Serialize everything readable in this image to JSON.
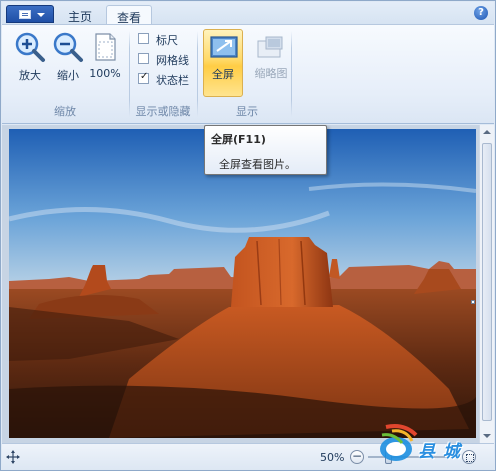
{
  "tabs": {
    "home": "主页",
    "view": "查看"
  },
  "help_icon": "?",
  "groups": {
    "zoom": {
      "label": "缩放",
      "zoom_in": "放大",
      "zoom_out": "缩小",
      "actual_size": "100%"
    },
    "show_hide": {
      "label": "显示或隐藏",
      "ruler": {
        "label": "标尺",
        "checked": false
      },
      "gridlines": {
        "label": "网格线",
        "checked": false
      },
      "statusbar": {
        "label": "状态栏",
        "checked": true
      }
    },
    "display": {
      "label": "显示",
      "fullscreen": "全屏",
      "thumbnail": "缩略图"
    }
  },
  "tooltip": {
    "title": "全屏(F11)",
    "description": "全屏查看图片。"
  },
  "status": {
    "zoom_percent": "50%",
    "zoom_out_symbol": "−"
  },
  "watermark": {
    "text": "县  城"
  },
  "colors": {
    "ribbon_bg": "#e6eef9",
    "highlight": "#ffd968",
    "accent": "#1f4fa6",
    "sky_top": "#2f6fc2",
    "rock": "#b4451a"
  }
}
